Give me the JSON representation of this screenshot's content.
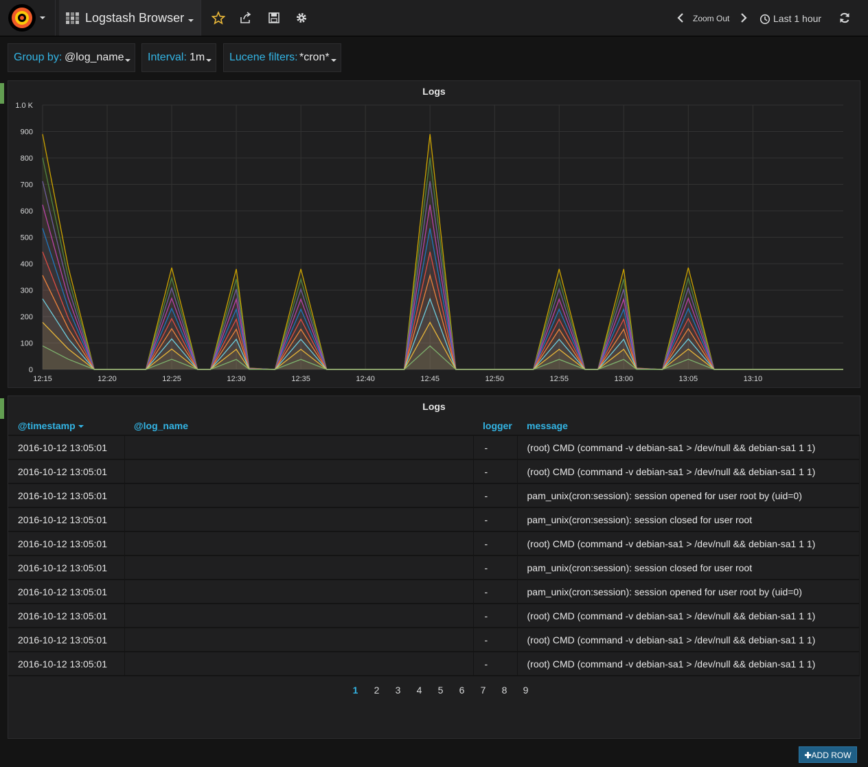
{
  "navbar": {
    "logo_icon": "grafana-logo-icon",
    "dashboard_title": "Logstash Browser",
    "icons": [
      "star-icon",
      "share-icon",
      "save-icon",
      "gear-icon"
    ],
    "zoom_out_label": "Zoom Out",
    "time_range": "Last 1 hour",
    "refresh_icon": "refresh-icon"
  },
  "filters": [
    {
      "key": "Group by:",
      "value": "@log_name"
    },
    {
      "key": "Interval:",
      "value": "1m"
    },
    {
      "key": "Lucene filters:",
      "value": "*cron*"
    }
  ],
  "graph_panel": {
    "title": "Logs"
  },
  "chart_data": {
    "type": "area",
    "title": "Logs",
    "x": [
      "12:15",
      "12:17",
      "12:19",
      "12:23",
      "12:25",
      "12:27",
      "12:28",
      "12:30",
      "12:31",
      "12:33",
      "12:35",
      "12:37",
      "12:43",
      "12:45",
      "12:47",
      "12:53",
      "12:55",
      "12:57",
      "12:58",
      "13:00",
      "13:01",
      "13:03",
      "13:05",
      "13:07",
      "13:17"
    ],
    "x_ticks": [
      "12:15",
      "12:20",
      "12:25",
      "12:30",
      "12:35",
      "12:40",
      "12:45",
      "12:50",
      "12:55",
      "13:00",
      "13:05",
      "13:10"
    ],
    "y_ticks": [
      "0",
      "100",
      "200",
      "300",
      "400",
      "500",
      "600",
      "700",
      "800",
      "900",
      "1.0 K"
    ],
    "ylim": [
      0,
      1000
    ],
    "stacked": true,
    "totals": [
      890,
      385,
      0,
      0,
      385,
      0,
      0,
      380,
      5,
      0,
      380,
      0,
      0,
      890,
      0,
      0,
      380,
      0,
      0,
      380,
      5,
      0,
      385,
      0,
      0
    ],
    "series_colors": [
      "#7eb26d",
      "#eab839",
      "#6ed0e0",
      "#ef843c",
      "#e24d42",
      "#1f78c1",
      "#ba43a9",
      "#705da0",
      "#508642",
      "#cca300"
    ],
    "grid": true,
    "legend": "none"
  },
  "table_panel": {
    "title": "Logs",
    "columns": [
      "@timestamp",
      "@log_name",
      "logger",
      "message"
    ],
    "rows": [
      [
        "2016-10-12 13:05:01",
        "",
        "-",
        "(root) CMD (command -v debian-sa1 > /dev/null && debian-sa1 1 1)"
      ],
      [
        "2016-10-12 13:05:01",
        "",
        "-",
        "(root) CMD (command -v debian-sa1 > /dev/null && debian-sa1 1 1)"
      ],
      [
        "2016-10-12 13:05:01",
        "",
        "-",
        "pam_unix(cron:session): session opened for user root by (uid=0)"
      ],
      [
        "2016-10-12 13:05:01",
        "",
        "-",
        "pam_unix(cron:session): session closed for user root"
      ],
      [
        "2016-10-12 13:05:01",
        "",
        "-",
        "(root) CMD (command -v debian-sa1 > /dev/null && debian-sa1 1 1)"
      ],
      [
        "2016-10-12 13:05:01",
        "",
        "-",
        "pam_unix(cron:session): session closed for user root"
      ],
      [
        "2016-10-12 13:05:01",
        "",
        "-",
        "pam_unix(cron:session): session opened for user root by (uid=0)"
      ],
      [
        "2016-10-12 13:05:01",
        "",
        "-",
        "(root) CMD (command -v debian-sa1 > /dev/null && debian-sa1 1 1)"
      ],
      [
        "2016-10-12 13:05:01",
        "",
        "-",
        "(root) CMD (command -v debian-sa1 > /dev/null && debian-sa1 1 1)"
      ],
      [
        "2016-10-12 13:05:01",
        "",
        "-",
        "(root) CMD (command -v debian-sa1 > /dev/null && debian-sa1 1 1)"
      ]
    ],
    "pages": [
      "1",
      "2",
      "3",
      "4",
      "5",
      "6",
      "7",
      "8",
      "9"
    ],
    "active_page": "1"
  },
  "add_row_label": "ADD ROW",
  "colors": {
    "accent": "#33b5e5",
    "row_marker": "#629e51",
    "background": "#141414",
    "panel": "#1f1f20"
  }
}
